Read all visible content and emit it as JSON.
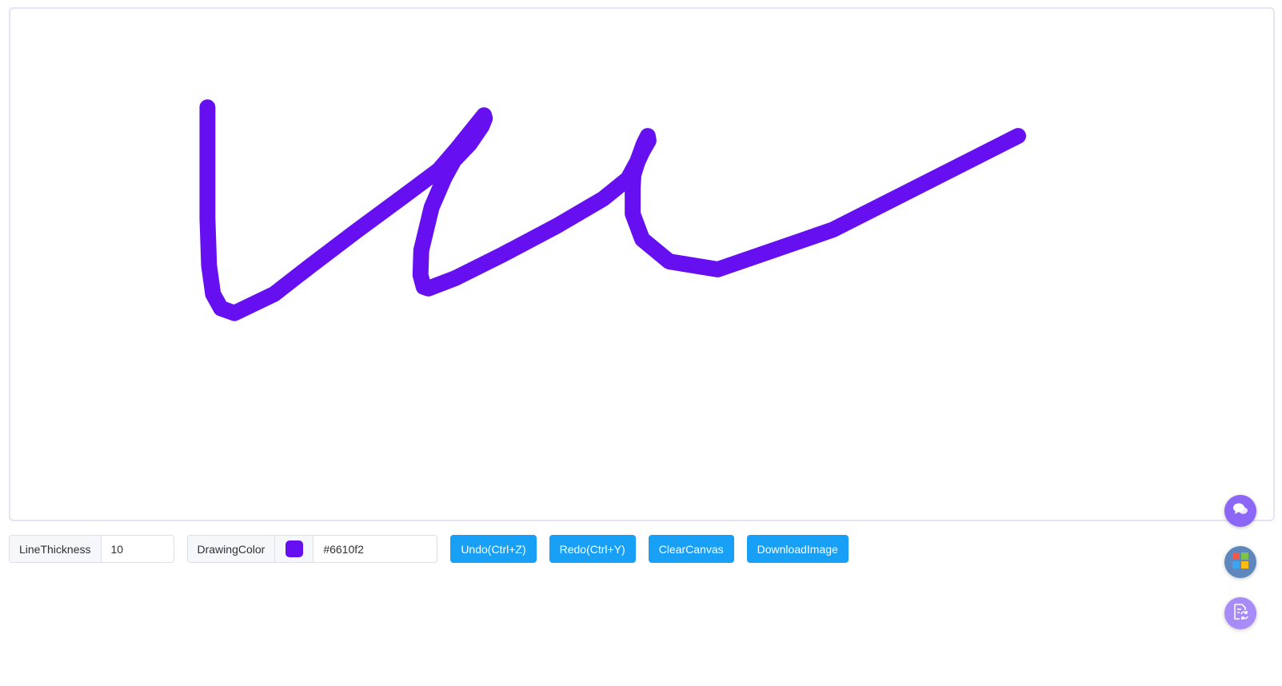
{
  "canvas": {
    "stroke_color": "#6610f2",
    "stroke_thickness": 10
  },
  "toolbar": {
    "line_thickness_label": "LineThickness",
    "line_thickness_value": "10",
    "drawing_color_label": "DrawingColor",
    "drawing_color_value": "#6610f2",
    "undo_label": "Undo(Ctrl+Z)",
    "redo_label": "Redo(Ctrl+Y)",
    "clear_label": "ClearCanvas",
    "download_label": "DownloadImage"
  },
  "floating_buttons": {
    "chat_icon": "chat-bubbles-icon",
    "apps_icon": "windows-grid-icon",
    "doc_icon": "document-refresh-icon"
  },
  "colors": {
    "accent": "#17a0f5",
    "stroke": "#6610f2",
    "fab_purple": "#8b66f7",
    "fab_blue": "#5e88bd"
  }
}
